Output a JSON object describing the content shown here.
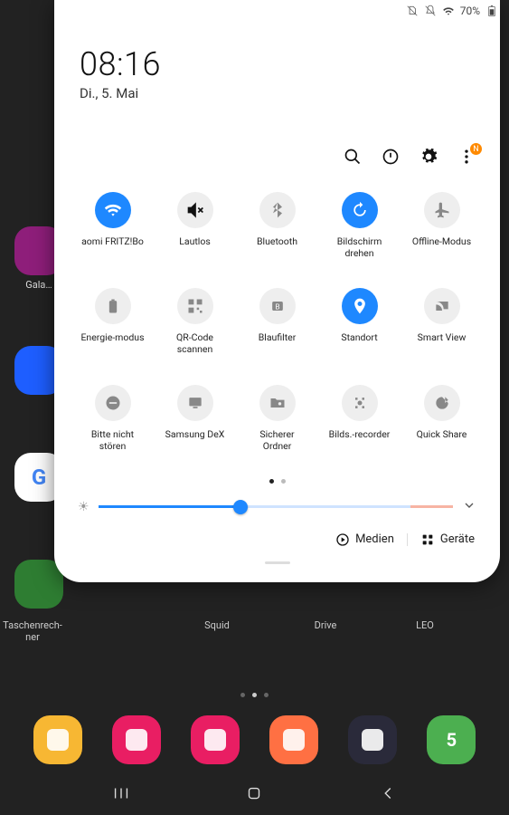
{
  "statusbar": {
    "battery_pct": "70%"
  },
  "clock": {
    "time": "08:16",
    "date": "Di., 5. Mai"
  },
  "utils": {
    "notif_letter": "N"
  },
  "tiles": [
    {
      "name": "wifi",
      "label": "aomi FRITZ!Bo",
      "active": true,
      "icon": "wifi"
    },
    {
      "name": "mute",
      "label": "Lautlos",
      "active": false,
      "icon": "mute"
    },
    {
      "name": "bluetooth",
      "label": "Bluetooth",
      "active": false,
      "icon": "bluetooth"
    },
    {
      "name": "rotate",
      "label": "Bildschirm drehen",
      "active": true,
      "icon": "rotate"
    },
    {
      "name": "airplane",
      "label": "Offline-Modus",
      "active": false,
      "icon": "airplane"
    },
    {
      "name": "energy",
      "label": "Energie-modus",
      "active": false,
      "icon": "battery"
    },
    {
      "name": "qr",
      "label": "QR-Code scannen",
      "active": false,
      "icon": "qr"
    },
    {
      "name": "bluefilter",
      "label": "Blaufilter",
      "active": false,
      "icon": "eye"
    },
    {
      "name": "location",
      "label": "Standort",
      "active": true,
      "icon": "pin"
    },
    {
      "name": "smartview",
      "label": "Smart View",
      "active": false,
      "icon": "cast"
    },
    {
      "name": "dnd",
      "label": "Bitte nicht stören",
      "active": false,
      "icon": "dnd"
    },
    {
      "name": "dex",
      "label": "Samsung DeX",
      "active": false,
      "icon": "dex"
    },
    {
      "name": "secure",
      "label": "Sicherer Ordner",
      "active": false,
      "icon": "folder"
    },
    {
      "name": "screenrec",
      "label": "Bilds.-recorder",
      "active": false,
      "icon": "rec"
    },
    {
      "name": "quickshare",
      "label": "Quick Share",
      "active": false,
      "icon": "share"
    }
  ],
  "pager": {
    "count": 2,
    "active": 0
  },
  "brightness": {
    "value_pct": 40,
    "warm_start_pct": 88
  },
  "bottom": {
    "media": "Medien",
    "devices": "Geräte"
  },
  "bg_apps": {
    "left_label": "Gala…",
    "under_labels": [
      "Taschenrech-\nner",
      "Squid",
      "Drive",
      "LEO"
    ]
  },
  "dock": [
    {
      "name": "files",
      "color": "#f7b733"
    },
    {
      "name": "gallery",
      "color": "#e91e63"
    },
    {
      "name": "camera",
      "color": "#e91e63"
    },
    {
      "name": "notes",
      "color": "#ff7043"
    },
    {
      "name": "browser",
      "color": "#2a2a3a"
    },
    {
      "name": "calendar",
      "color": "#4caf50",
      "day": "5"
    }
  ]
}
